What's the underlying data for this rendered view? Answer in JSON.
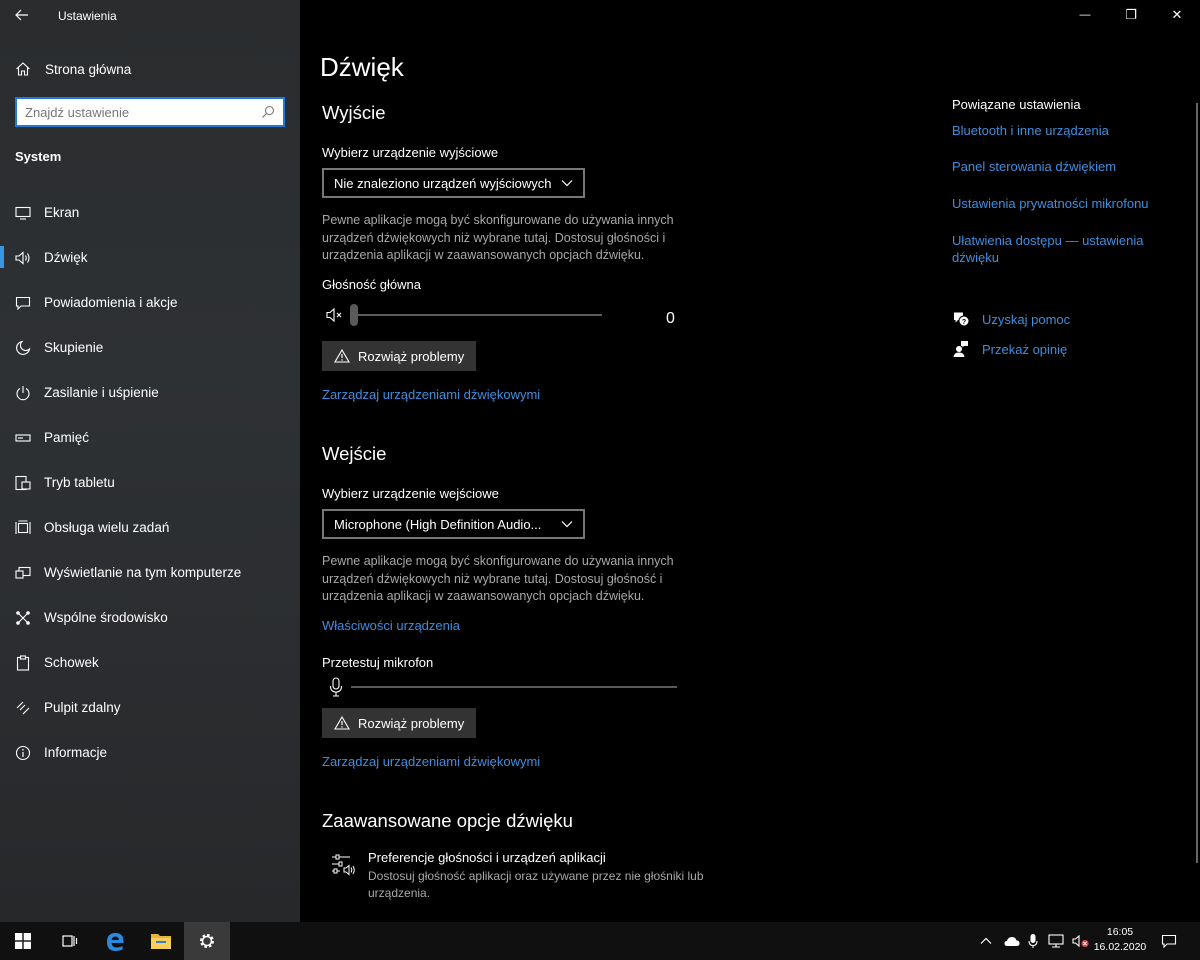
{
  "window": {
    "app_title": "Ustawienia",
    "minimize": "—",
    "maximize": "❐",
    "close": "✕"
  },
  "sidebar": {
    "home_label": "Strona główna",
    "search_placeholder": "Znajdź ustawienie",
    "section": "System",
    "items": [
      {
        "label": "Ekran",
        "icon": "display-icon"
      },
      {
        "label": "Dźwięk",
        "icon": "speaker-icon",
        "active": true
      },
      {
        "label": "Powiadomienia i akcje",
        "icon": "notification-icon"
      },
      {
        "label": "Skupienie",
        "icon": "moon-icon"
      },
      {
        "label": "Zasilanie i uśpienie",
        "icon": "power-icon"
      },
      {
        "label": "Pamięć",
        "icon": "storage-icon"
      },
      {
        "label": "Tryb tabletu",
        "icon": "tablet-icon"
      },
      {
        "label": "Obsługa wielu zadań",
        "icon": "multitask-icon"
      },
      {
        "label": "Wyświetlanie na tym komputerze",
        "icon": "project-icon"
      },
      {
        "label": "Wspólne środowisko",
        "icon": "shared-icon"
      },
      {
        "label": "Schowek",
        "icon": "clipboard-icon"
      },
      {
        "label": "Pulpit zdalny",
        "icon": "remote-desktop-icon"
      },
      {
        "label": "Informacje",
        "icon": "info-icon"
      }
    ]
  },
  "main": {
    "title": "Dźwięk",
    "output": {
      "heading": "Wyjście",
      "select_label": "Wybierz urządzenie wyjściowe",
      "selected_device": "Nie znaleziono urządzeń wyjściowych",
      "description": "Pewne aplikacje mogą być skonfigurowane do używania innych urządzeń dźwiękowych niż wybrane tutaj. Dostosuj głośności i urządzenia aplikacji w zaawansowanych opcjach dźwięku.",
      "volume_label": "Głośność główna",
      "volume_value": "0",
      "troubleshoot": "Rozwiąż problemy",
      "manage_link": "Zarządzaj urządzeniami dźwiękowymi"
    },
    "input": {
      "heading": "Wejście",
      "select_label": "Wybierz urządzenie wejściowe",
      "selected_device": "Microphone (High Definition Audio...",
      "description": "Pewne aplikacje mogą być skonfigurowane do używania innych urządzeń dźwiękowych niż wybrane tutaj. Dostosuj głośność i urządzenia aplikacji w zaawansowanych opcjach dźwięku.",
      "properties_link": "Właściwości urządzenia",
      "test_label": "Przetestuj mikrofon",
      "troubleshoot": "Rozwiąż problemy",
      "manage_link": "Zarządzaj urządzeniami dźwiękowymi"
    },
    "advanced": {
      "heading": "Zaawansowane opcje dźwięku",
      "item_title": "Preferencje głośności i urządzeń aplikacji",
      "item_desc": "Dostosuj głośność aplikacji oraz używane przez nie głośniki lub urządzenia."
    }
  },
  "related": {
    "title": "Powiązane ustawienia",
    "links": [
      "Bluetooth i inne urządzenia",
      "Panel sterowania dźwiękiem",
      "Ustawienia prywatności mikrofonu",
      "Ułatwienia dostępu — ustawienia dźwięku"
    ],
    "help": "Uzyskaj pomoc",
    "feedback": "Przekaż opinię"
  },
  "taskbar": {
    "time": "16:05",
    "date": "16.02.2020"
  },
  "colors": {
    "accent": "#3b95e5",
    "link": "#3e8ede",
    "sidebar_bg": "#2b2d30",
    "main_bg": "#000000",
    "button_bg": "#333333"
  }
}
